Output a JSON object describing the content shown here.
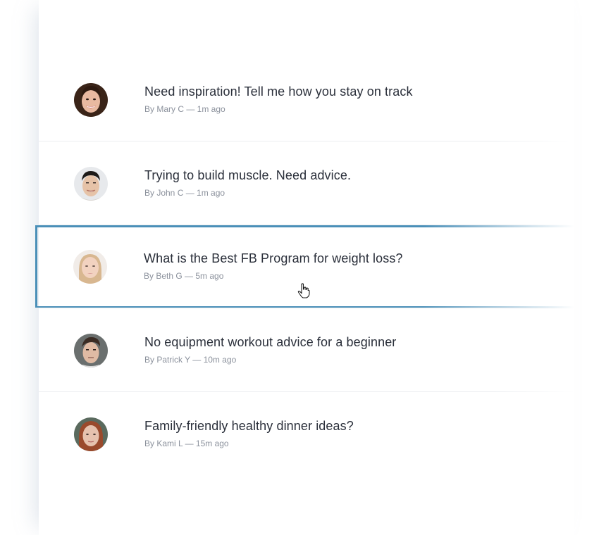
{
  "threads": [
    {
      "title": "Need inspiration! Tell me how you stay on track",
      "author_line": "By Mary C — 1m ago",
      "avatar": "avatar-mary",
      "selected": false
    },
    {
      "title": "Trying to build muscle. Need advice.",
      "author_line": "By John C — 1m ago",
      "avatar": "avatar-john",
      "selected": false
    },
    {
      "title": "What is the Best FB Program for weight loss?",
      "author_line": "By Beth G — 5m ago",
      "avatar": "avatar-beth",
      "selected": true
    },
    {
      "title": "No equipment workout advice for a beginner",
      "author_line": "By Patrick Y — 10m ago",
      "avatar": "avatar-patrick",
      "selected": false
    },
    {
      "title": "Family-friendly healthy dinner ideas?",
      "author_line": "By Kami L — 15m ago",
      "avatar": "avatar-kami",
      "selected": false
    }
  ],
  "colors": {
    "selection_border": "#4a8fb8",
    "title_text": "#2a2f3a",
    "meta_text": "#8b919c",
    "divider": "#eceef1"
  },
  "icons": {
    "cursor": "hand-pointer-cursor-icon"
  }
}
